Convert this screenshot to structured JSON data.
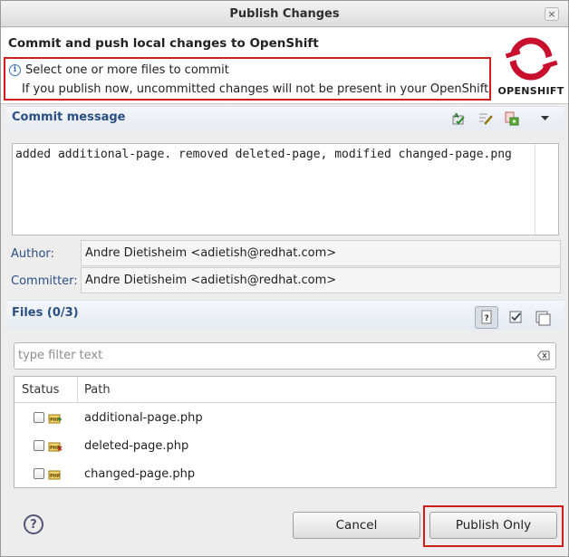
{
  "window": {
    "title": "Publish Changes",
    "close_label": "×"
  },
  "header": {
    "title": "Commit and push local changes to OpenShift",
    "message_line1": "Select one or more files to commit",
    "message_line2": "If you publish now, uncommitted changes will not be present in your OpenShift",
    "logo_text": "OPENSHIFT"
  },
  "commit": {
    "section_title": "Commit message",
    "message": "added additional-page. removed deleted-page, modified changed-page.png",
    "author_label": "Author:",
    "author_value": "Andre Dietisheim <adietish@redhat.com>",
    "committer_label": "Committer:",
    "committer_value": "Andre Dietisheim <adietish@redhat.com>"
  },
  "files": {
    "section_title": "Files (0/3)",
    "filter_placeholder": "type filter text",
    "columns": [
      "Status",
      "Path"
    ],
    "rows": [
      {
        "path": "additional-page.php",
        "status": "added",
        "checked": false
      },
      {
        "path": "deleted-page.php",
        "status": "removed",
        "checked": false
      },
      {
        "path": "changed-page.php",
        "status": "modified",
        "checked": false
      }
    ]
  },
  "buttons": {
    "help": "?",
    "cancel": "Cancel",
    "publish": "Publish Only"
  },
  "colors": {
    "accent_red": "#d01e1e",
    "section_blue": "#2b4f82",
    "logo_red": "#c8102e"
  }
}
